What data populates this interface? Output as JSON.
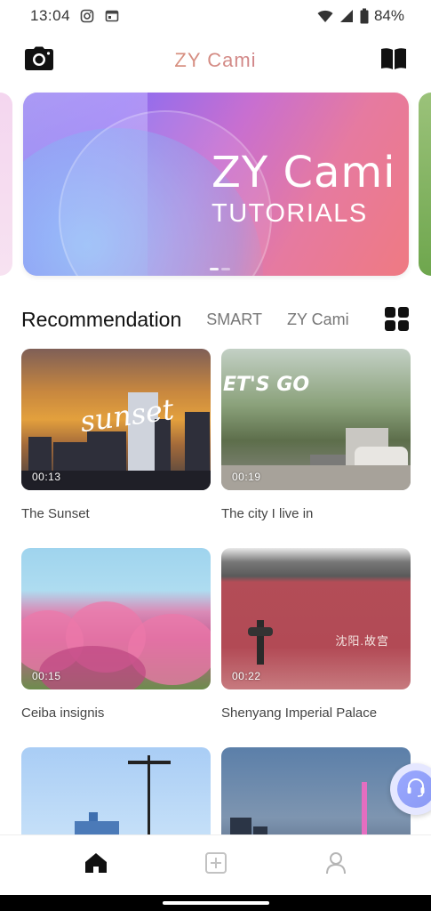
{
  "status_bar": {
    "time": "13:04",
    "battery": "84%",
    "icons": [
      "instagram-icon",
      "calendar-icon",
      "wifi-icon",
      "signal-icon",
      "battery-icon"
    ]
  },
  "header": {
    "title": "ZY Cami",
    "left_icon": "camera-icon",
    "right_icon": "book-icon"
  },
  "banner": {
    "title": "ZY Cami",
    "subtitle": "TUTORIALS",
    "dots": 2,
    "active_dot": 0
  },
  "tabs": [
    {
      "label": "Recommendation",
      "active": true
    },
    {
      "label": "SMART",
      "active": false
    },
    {
      "label": "ZY Cami",
      "active": false
    }
  ],
  "videos": [
    {
      "title": "The Sunset",
      "duration": "00:13",
      "overlay": "sunset"
    },
    {
      "title": "The city I live in",
      "duration": "00:19",
      "overlay": "ET'S GO"
    },
    {
      "title": "Ceiba insignis",
      "duration": "00:15",
      "overlay": ""
    },
    {
      "title": "Shenyang Imperial Palace",
      "duration": "00:22",
      "overlay": "沈阳.故宫"
    },
    {
      "title": "",
      "duration": "",
      "overlay": ""
    },
    {
      "title": "",
      "duration": "",
      "overlay": ""
    }
  ],
  "bottom_nav": [
    {
      "icon": "home-icon",
      "active": true
    },
    {
      "icon": "add-square-icon",
      "active": false
    },
    {
      "icon": "profile-icon",
      "active": false
    }
  ],
  "colors": {
    "title_gradient_start": "#e6a56a",
    "title_gradient_end": "#c2719e",
    "active_nav": "#111111",
    "inactive_nav": "#bbbbbb"
  }
}
